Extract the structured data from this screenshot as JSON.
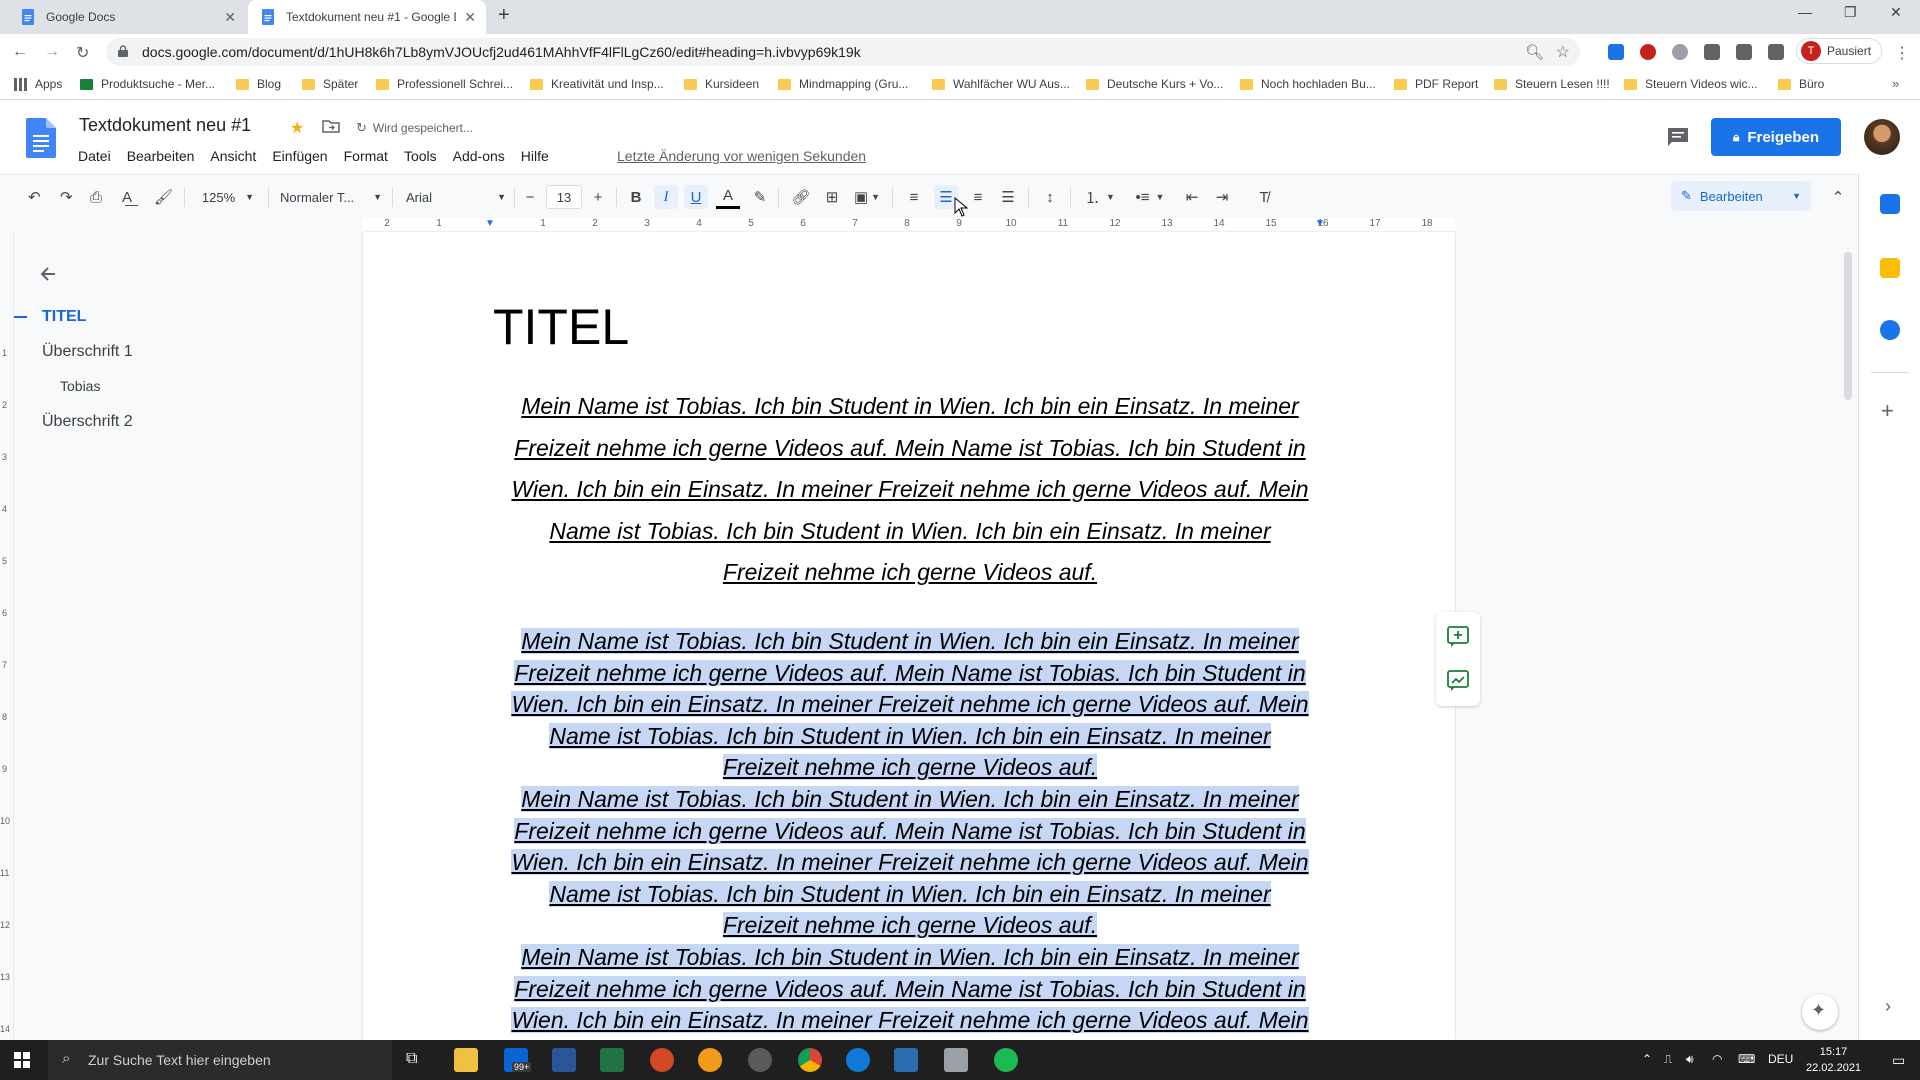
{
  "browser": {
    "tabs": [
      {
        "title": "Google Docs"
      },
      {
        "title": "Textdokument neu #1 - Google D"
      }
    ],
    "url": "docs.google.com/document/d/1hUH8k6h7Lb8ymVJOUcfj2ud461MAhhVfF4lFlLgCz60/edit#heading=h.ivbvyp69k19k",
    "profile_status": "Pausiert",
    "profile_initial": "T",
    "bookmarks": [
      "Apps",
      "Produktsuche - Mer...",
      "Blog",
      "Später",
      "Professionell Schrei...",
      "Kreativität und Insp...",
      "Kursideen",
      "Mindmapping  (Gru...",
      "Wahlfächer WU Aus...",
      "Deutsche Kurs + Vo...",
      "Noch hochladen Bu...",
      "PDF Report",
      "Steuern Lesen !!!!",
      "Steuern Videos wic...",
      "Büro"
    ]
  },
  "docs": {
    "title": "Textdokument neu #1",
    "save_status": "Wird gespeichert...",
    "menu": [
      "Datei",
      "Bearbeiten",
      "Ansicht",
      "Einfügen",
      "Format",
      "Tools",
      "Add-ons",
      "Hilfe"
    ],
    "last_edit": "Letzte Änderung vor wenigen Sekunden",
    "share_label": "Freigeben",
    "toolbar": {
      "zoom": "125%",
      "style": "Normaler T...",
      "font": "Arial",
      "font_size": "13",
      "mode": "Bearbeiten"
    },
    "ruler_numbers": [
      "2",
      "1",
      "1",
      "2",
      "3",
      "4",
      "5",
      "6",
      "7",
      "8",
      "9",
      "10",
      "11",
      "12",
      "13",
      "14",
      "15",
      "16",
      "17",
      "18"
    ],
    "vruler_numbers": [
      "1",
      "2",
      "3",
      "4",
      "5",
      "6",
      "7",
      "8",
      "9",
      "10",
      "11",
      "12",
      "13",
      "14"
    ],
    "outline": [
      {
        "label": "TITEL",
        "level": 0,
        "active": true
      },
      {
        "label": "Überschrift 1",
        "level": 1
      },
      {
        "label": "Tobias",
        "level": 2
      },
      {
        "label": "Überschrift 2",
        "level": 1
      }
    ],
    "document": {
      "heading": "TITEL",
      "para1_lines": [
        "Mein Name ist Tobias. Ich bin Student in Wien. Ich bin ein Einsatz. In meiner",
        "Freizeit nehme ich gerne Videos auf. Mein Name ist Tobias. Ich bin Student in",
        "Wien. Ich bin ein Einsatz. In meiner Freizeit nehme ich gerne Videos auf. Mein",
        "Name ist Tobias. Ich bin Student in Wien. Ich bin ein Einsatz. In meiner",
        "Freizeit nehme ich gerne Videos auf."
      ],
      "para2_lines": [
        "Mein Name ist Tobias. Ich bin Student in Wien. Ich bin ein Einsatz. In meiner",
        "Freizeit nehme ich gerne Videos auf. Mein Name ist Tobias. Ich bin Student in",
        "Wien. Ich bin ein Einsatz. In meiner Freizeit nehme ich gerne Videos auf. Mein",
        "Name ist Tobias. Ich bin Student in Wien. Ich bin ein Einsatz. In meiner",
        "Freizeit nehme ich gerne Videos auf.",
        "Mein Name ist Tobias. Ich bin Student in Wien. Ich bin ein Einsatz. In meiner",
        "Freizeit nehme ich gerne Videos auf. Mein Name ist Tobias. Ich bin Student in",
        "Wien. Ich bin ein Einsatz. In meiner Freizeit nehme ich gerne Videos auf. Mein",
        "Name ist Tobias. Ich bin Student in Wien. Ich bin ein Einsatz. In meiner",
        "Freizeit nehme ich gerne Videos auf.",
        "Mein Name ist Tobias. Ich bin Student in Wien. Ich bin ein Einsatz. In meiner",
        "Freizeit nehme ich gerne Videos auf. Mein Name ist Tobias. Ich bin Student in",
        "Wien. Ich bin ein Einsatz. In meiner Freizeit nehme ich gerne Videos auf. Mein"
      ]
    }
  },
  "taskbar": {
    "search_placeholder": "Zur Suche Text hier eingeben",
    "badge": "99+",
    "language": "DEU",
    "time": "15:17",
    "date": "22.02.2021"
  },
  "colors": {
    "accent": "#1a73e8",
    "selection": "#c6d7f5",
    "outline_active": "#1967d2"
  }
}
